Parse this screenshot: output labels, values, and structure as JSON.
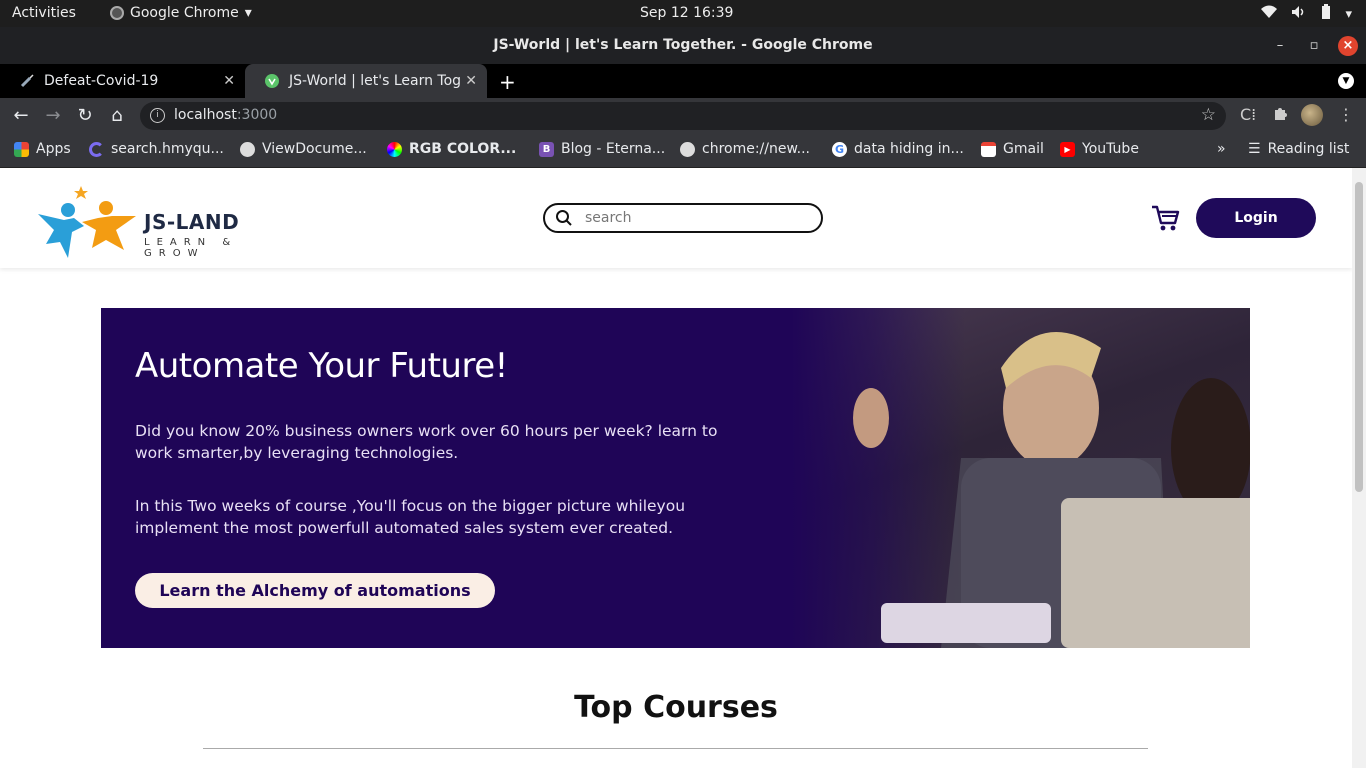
{
  "system_bar": {
    "activities": "Activities",
    "app_name": "Google Chrome",
    "clock": "Sep 12  16:39"
  },
  "window": {
    "title": "JS-World | let's Learn Together. - Google Chrome"
  },
  "tabs": [
    {
      "label": "Defeat-Covid-19",
      "active": false
    },
    {
      "label": "JS-World | let's Learn Tog",
      "active": true
    }
  ],
  "address_bar": {
    "host": "localhost",
    "port": ":3000"
  },
  "bookmarks": [
    {
      "label": "Apps",
      "icon": "apps-grid-icon"
    },
    {
      "label": "search.hmyqu...",
      "icon": "spinner-icon"
    },
    {
      "label": "ViewDocume...",
      "icon": "globe-icon"
    },
    {
      "label": "RGB COLOR...",
      "icon": "color-wheel-icon"
    },
    {
      "label": "Blog - Eterna...",
      "icon": "bootstrap-icon"
    },
    {
      "label": "chrome://new...",
      "icon": "globe-icon"
    },
    {
      "label": "data hiding in...",
      "icon": "google-icon"
    },
    {
      "label": "Gmail",
      "icon": "gmail-icon"
    },
    {
      "label": "YouTube",
      "icon": "youtube-icon"
    }
  ],
  "bookmarks_more": "»",
  "reading_list": "Reading list",
  "site": {
    "logo_title": "JS-LAND",
    "logo_tagline": "LEARN & GROW",
    "search_placeholder": "search",
    "login_label": "Login",
    "accent_color": "#1f0557"
  },
  "hero": {
    "heading": "Automate Your Future!",
    "para1": "Did you know 20% business owners work over 60 hours per week? learn to work smarter,by leveraging technologies.",
    "para2": "In this Two weeks of course ,You'll focus on the bigger picture whileyou implement the most powerfull automated sales system ever created.",
    "cta_label": "Learn the Alchemy of automations"
  },
  "sections": {
    "top_courses_title": "Top Courses"
  }
}
